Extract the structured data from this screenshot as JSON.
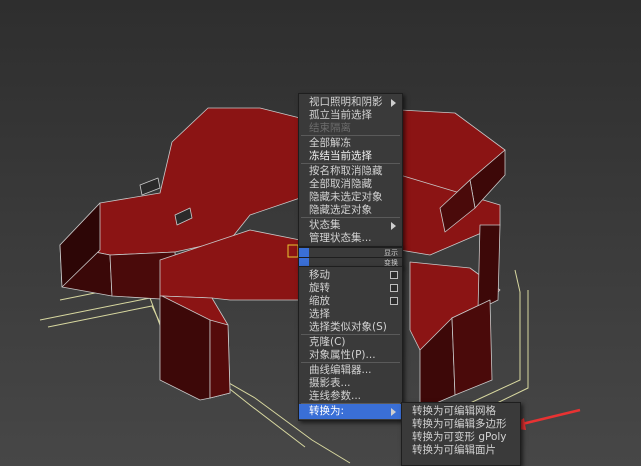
{
  "colors": {
    "background": "#3d3d3d",
    "building": "#8b1414",
    "outline": "#d8d8a0",
    "highlight": "#3a6fd6",
    "menu_bg": "#3a3a3a",
    "annotation_arrow": "#e83232"
  },
  "quad_menu": {
    "upper_items": [
      {
        "label": "视口照明和阴影",
        "submenu": true
      },
      {
        "label": "孤立当前选择"
      },
      {
        "label": "结束隔离",
        "disabled": true
      },
      {
        "label": "全部解冻"
      },
      {
        "label": "冻结当前选择",
        "bold": true
      },
      {
        "label": "按名称取消隐藏"
      },
      {
        "label": "全部取消隐藏"
      },
      {
        "label": "隐藏未选定对象"
      },
      {
        "label": "隐藏选定对象"
      },
      {
        "label": "状态集",
        "submenu": true
      },
      {
        "label": "管理状态集..."
      }
    ],
    "quad_labels": {
      "display": "显示",
      "transform": "变换"
    },
    "lower_items": [
      {
        "label": "移动",
        "option_box": true
      },
      {
        "label": "旋转",
        "option_box": true
      },
      {
        "label": "缩放",
        "option_box": true
      },
      {
        "label": "选择"
      },
      {
        "label": "选择类似对象(S)"
      },
      {
        "label": "克隆(C)"
      },
      {
        "label": "对象属性(P)..."
      },
      {
        "label": "曲线编辑器..."
      },
      {
        "label": "摄影表..."
      },
      {
        "label": "连线参数..."
      },
      {
        "label": "转换为:",
        "submenu": true,
        "highlight": true
      }
    ],
    "submenu_items": [
      {
        "label": "转换为可编辑网格"
      },
      {
        "label": "转换为可编辑多边形"
      },
      {
        "label": "转换为可变形 gPoly"
      },
      {
        "label": "转换为可编辑面片"
      }
    ]
  }
}
